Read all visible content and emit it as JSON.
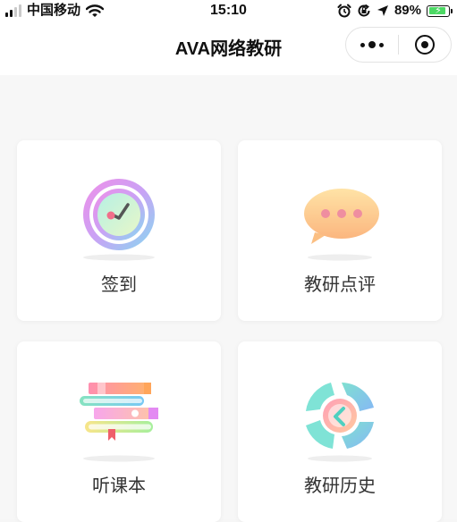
{
  "status_bar": {
    "carrier": "中国移动",
    "time": "15:10",
    "battery_percent": "89%",
    "battery_level": 0.89,
    "icons": [
      "signal-icon",
      "wifi-icon",
      "alarm-icon",
      "orientation-lock-icon",
      "location-icon",
      "battery-charging-icon"
    ]
  },
  "nav": {
    "title": "AVA网络教研",
    "menu_icon": "more-dots-icon",
    "close_icon": "close-miniprogram-icon"
  },
  "menu": [
    {
      "label": "签到",
      "icon": "clock-checkin-icon"
    },
    {
      "label": "教研点评",
      "icon": "speech-bubble-icon"
    },
    {
      "label": "听课本",
      "icon": "book-stack-icon"
    },
    {
      "label": "教研历史",
      "icon": "history-swirl-icon"
    }
  ],
  "colors": {
    "battery_fill": "#4cd964",
    "background": "#f7f7f7",
    "card": "#ffffff"
  }
}
